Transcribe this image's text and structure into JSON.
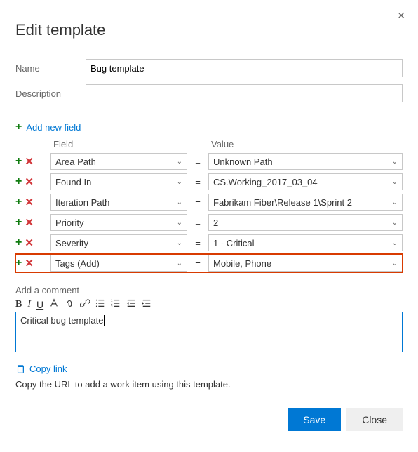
{
  "header": {
    "title": "Edit template"
  },
  "form": {
    "name_label": "Name",
    "name_value": "Bug template",
    "description_label": "Description",
    "description_value": ""
  },
  "add_field_label": "Add new field",
  "columns": {
    "field": "Field",
    "value": "Value"
  },
  "equals": "=",
  "rows": [
    {
      "field": "Area Path",
      "value": "Unknown Path",
      "highlighted": false
    },
    {
      "field": "Found In",
      "value": "CS.Working_2017_03_04",
      "highlighted": false
    },
    {
      "field": "Iteration Path",
      "value": "Fabrikam Fiber\\Release 1\\Sprint 2",
      "highlighted": false
    },
    {
      "field": "Priority",
      "value": "2",
      "highlighted": false
    },
    {
      "field": "Severity",
      "value": "1 - Critical",
      "highlighted": false
    },
    {
      "field": "Tags (Add)",
      "value": "Mobile, Phone",
      "highlighted": true
    }
  ],
  "comment": {
    "label": "Add a comment",
    "text": "Critical bug template"
  },
  "copy_link": {
    "label": "Copy link",
    "description": "Copy the URL to add a work item using this template."
  },
  "buttons": {
    "save": "Save",
    "close": "Close"
  }
}
